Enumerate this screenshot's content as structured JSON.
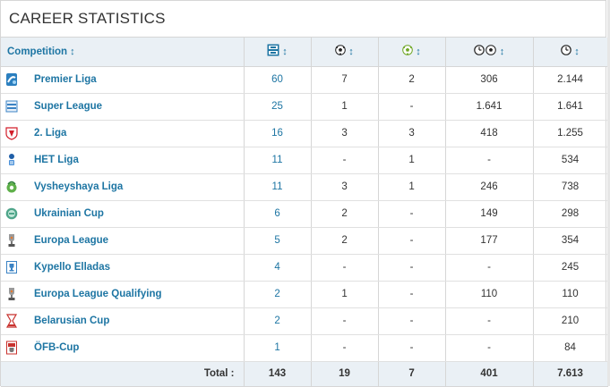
{
  "title": "CAREER STATISTICS",
  "header": {
    "competition": "Competition",
    "sort_glyph": "↕"
  },
  "header_icons": [
    "appearances-icon",
    "goals-icon",
    "assists-icon",
    "minutes-per-goal-icon",
    "minutes-played-icon"
  ],
  "rows": [
    {
      "name": "Premier Liga",
      "logo": "premier-liga-logo",
      "apps": "60",
      "goals": "7",
      "assists": "2",
      "min_per_goal": "306",
      "minutes": "2.144"
    },
    {
      "name": "Super League",
      "logo": "super-league-logo",
      "apps": "25",
      "goals": "1",
      "assists": "-",
      "min_per_goal": "1.641",
      "minutes": "1.641"
    },
    {
      "name": "2. Liga",
      "logo": "2-liga-logo",
      "apps": "16",
      "goals": "3",
      "assists": "3",
      "min_per_goal": "418",
      "minutes": "1.255"
    },
    {
      "name": "HET Liga",
      "logo": "het-liga-logo",
      "apps": "11",
      "goals": "-",
      "assists": "1",
      "min_per_goal": "-",
      "minutes": "534"
    },
    {
      "name": "Vysheyshaya Liga",
      "logo": "vysheyshaya-liga-logo",
      "apps": "11",
      "goals": "3",
      "assists": "1",
      "min_per_goal": "246",
      "minutes": "738"
    },
    {
      "name": "Ukrainian Cup",
      "logo": "ukrainian-cup-logo",
      "apps": "6",
      "goals": "2",
      "assists": "-",
      "min_per_goal": "149",
      "minutes": "298"
    },
    {
      "name": "Europa League",
      "logo": "europa-league-logo",
      "apps": "5",
      "goals": "2",
      "assists": "-",
      "min_per_goal": "177",
      "minutes": "354"
    },
    {
      "name": "Kypello Elladas",
      "logo": "kypello-elladas-logo",
      "apps": "4",
      "goals": "-",
      "assists": "-",
      "min_per_goal": "-",
      "minutes": "245"
    },
    {
      "name": "Europa League Qualifying",
      "logo": "europa-league-qualifying-logo",
      "apps": "2",
      "goals": "1",
      "assists": "-",
      "min_per_goal": "110",
      "minutes": "110"
    },
    {
      "name": "Belarusian Cup",
      "logo": "belarusian-cup-logo",
      "apps": "2",
      "goals": "-",
      "assists": "-",
      "min_per_goal": "-",
      "minutes": "210"
    },
    {
      "name": "ÖFB-Cup",
      "logo": "ofb-cup-logo",
      "apps": "1",
      "goals": "-",
      "assists": "-",
      "min_per_goal": "-",
      "minutes": "84"
    }
  ],
  "total": {
    "label": "Total :",
    "apps": "143",
    "goals": "19",
    "assists": "7",
    "min_per_goal": "401",
    "minutes": "7.613"
  },
  "colors": {
    "link": "#1d75a3",
    "header_bg": "#eaf0f5",
    "border": "#d6d6d6"
  }
}
